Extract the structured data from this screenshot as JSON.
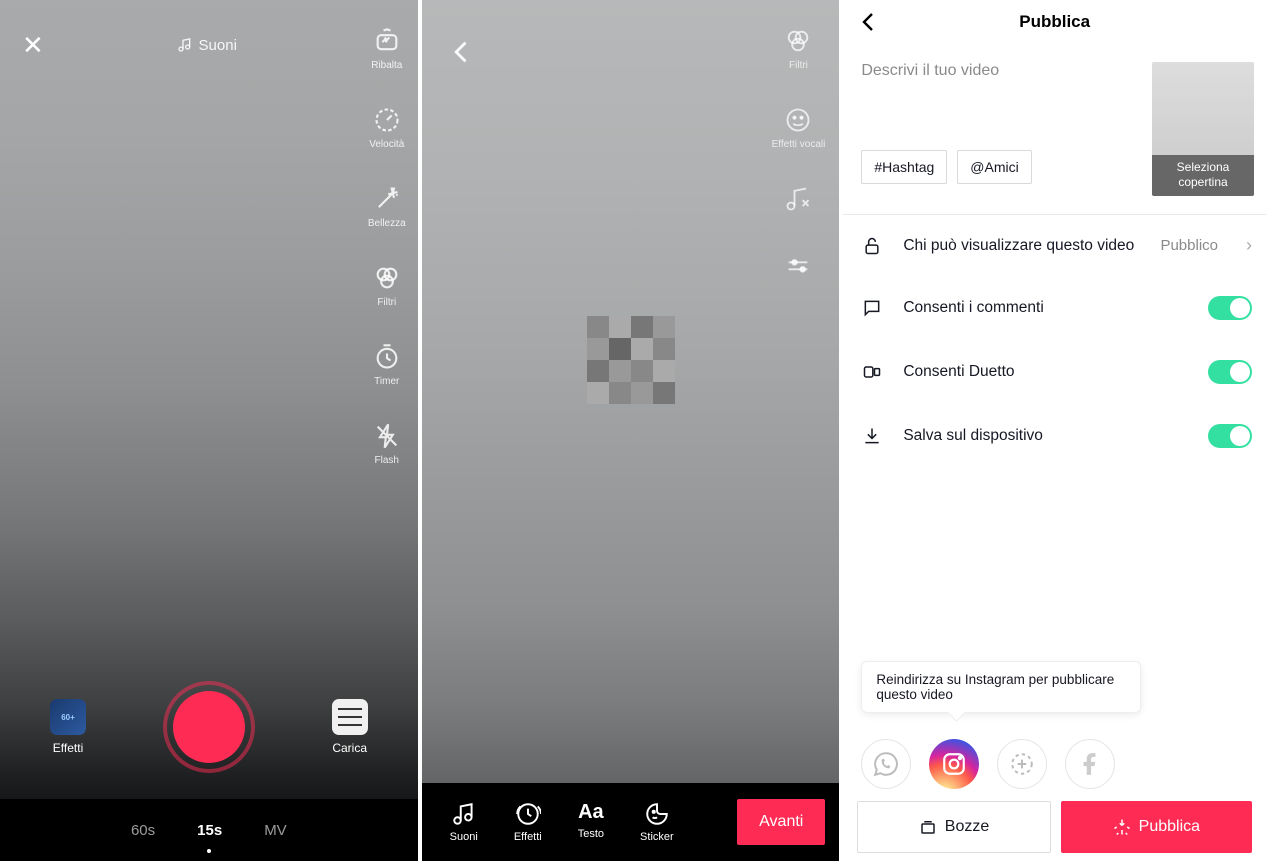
{
  "panel1": {
    "sounds_label": "Suoni",
    "side": [
      {
        "label": "Ribalta"
      },
      {
        "label": "Velocità"
      },
      {
        "label": "Bellezza"
      },
      {
        "label": "Filtri"
      },
      {
        "label": "Timer"
      },
      {
        "label": "Flash"
      }
    ],
    "effects_label": "Effetti",
    "effects_thumb_text": "60+",
    "upload_label": "Carica",
    "modes": {
      "m60": "60s",
      "m15": "15s",
      "mv": "MV"
    }
  },
  "panel2": {
    "side": [
      {
        "label": "Filtri"
      },
      {
        "label": "Effetti vocali"
      },
      {
        "label": ""
      },
      {
        "label": ""
      }
    ],
    "toolbar": {
      "suoni": "Suoni",
      "effetti": "Effetti",
      "testo": "Testo",
      "sticker": "Sticker"
    },
    "next": "Avanti"
  },
  "panel3": {
    "title": "Pubblica",
    "desc_placeholder": "Descrivi il tuo video",
    "hashtag_label": "#Hashtag",
    "friends_label": "@Amici",
    "cover_label": "Seleziona copertina",
    "privacy_label": "Chi può visualizzare questo video",
    "privacy_value": "Pubblico",
    "comments_label": "Consenti i commenti",
    "duet_label": "Consenti Duetto",
    "save_label": "Salva sul dispositivo",
    "share_tip": "Reindirizza su Instagram per pubblicare questo video",
    "draft_label": "Bozze",
    "publish_label": "Pubblica"
  }
}
